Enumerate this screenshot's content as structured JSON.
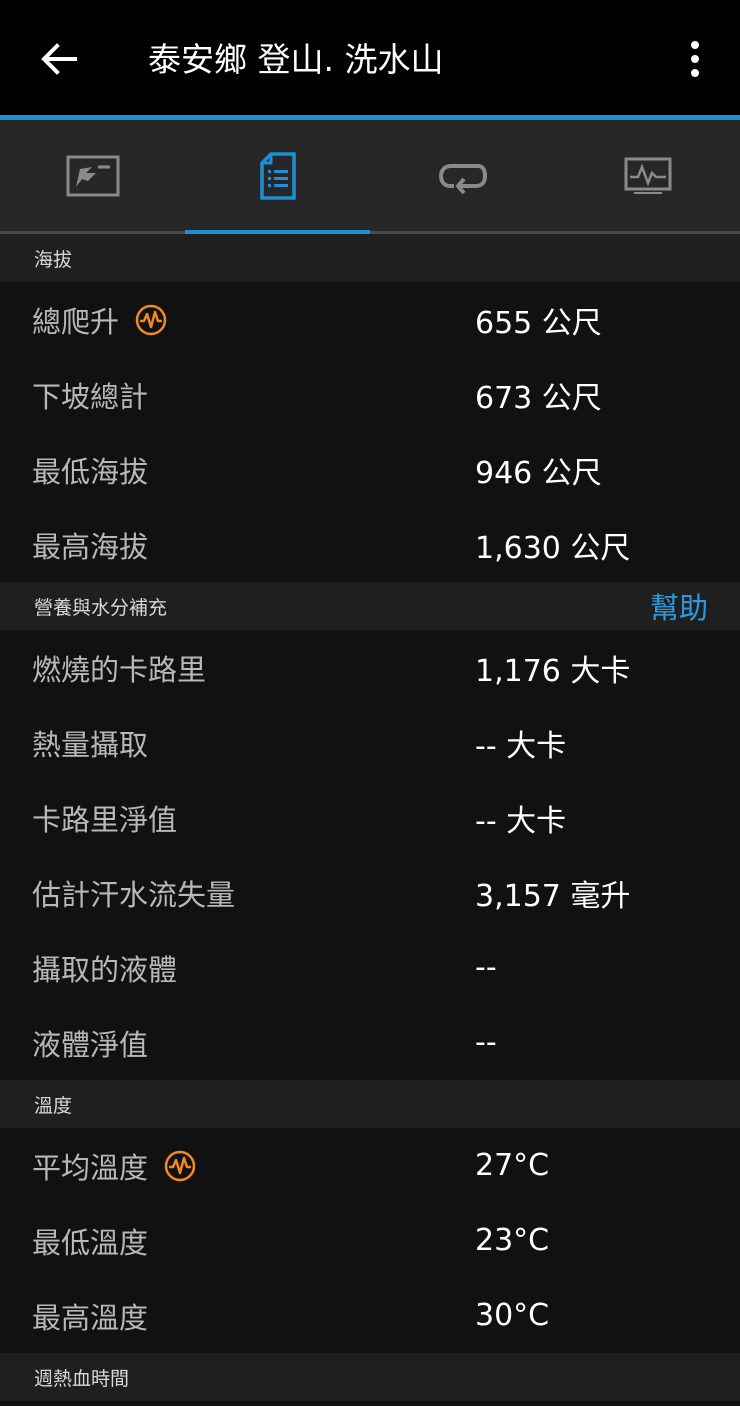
{
  "header": {
    "title": "泰安鄉 登山. 洗水山"
  },
  "tabs": [
    {
      "name": "map",
      "icon": "map-icon",
      "active": false
    },
    {
      "name": "stats",
      "icon": "stats-list-icon",
      "active": true
    },
    {
      "name": "laps",
      "icon": "laps-loop-icon",
      "active": false
    },
    {
      "name": "charts",
      "icon": "chart-icon",
      "active": false
    }
  ],
  "colors": {
    "accent": "#1e8fd4",
    "badge": "#f08a1c"
  },
  "elevation": {
    "title": "海拔",
    "rows": [
      {
        "label": "總爬升",
        "value": "655 公尺",
        "badge": "activity-icon"
      },
      {
        "label": "下坡總計",
        "value": "673 公尺"
      },
      {
        "label": "最低海拔",
        "value": "946 公尺"
      },
      {
        "label": "最高海拔",
        "value": "1,630 公尺"
      }
    ]
  },
  "nutrition": {
    "title": "營養與水分補充",
    "help": "幫助",
    "rows": [
      {
        "label": "燃燒的卡路里",
        "value": "1,176 大卡"
      },
      {
        "label": "熱量攝取",
        "value": "-- 大卡"
      },
      {
        "label": "卡路里淨值",
        "value": "-- 大卡"
      },
      {
        "label": "估計汗水流失量",
        "value": "3,157 毫升"
      },
      {
        "label": "攝取的液體",
        "value": "--"
      },
      {
        "label": "液體淨值",
        "value": "--"
      }
    ]
  },
  "temperature": {
    "title": "溫度",
    "rows": [
      {
        "label": "平均溫度",
        "value": "27°C",
        "badge": "activity-icon"
      },
      {
        "label": "最低溫度",
        "value": "23°C"
      },
      {
        "label": "最高溫度",
        "value": "30°C"
      }
    ]
  },
  "heat": {
    "title": "週熱血時間"
  }
}
